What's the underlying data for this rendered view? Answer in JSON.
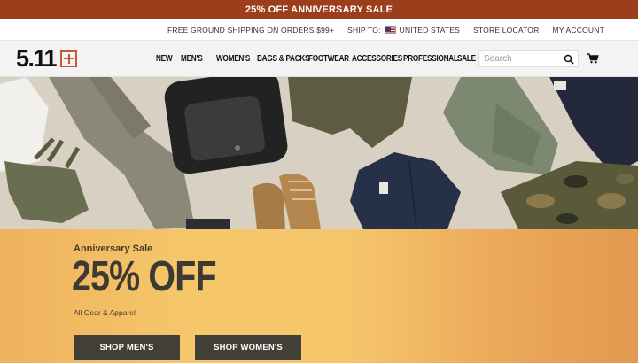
{
  "promo_bar": {
    "text": "25% OFF ANNIVERSARY SALE"
  },
  "utility": {
    "shipping": "FREE GROUND SHIPPING ON ORDERS $99+",
    "ship_to_label": "SHIP TO:",
    "ship_to_country": "UNITED STATES",
    "store_locator": "STORE LOCATOR",
    "account": "MY ACCOUNT"
  },
  "brand": {
    "logo_text": "5.11",
    "accent": "#c8583a"
  },
  "nav": {
    "items": [
      {
        "label": "NEW"
      },
      {
        "label": "MEN'S"
      },
      {
        "label": "WOMEN'S"
      },
      {
        "label": "BAGS & PACKS"
      },
      {
        "label": "FOOTWEAR"
      },
      {
        "label": "ACCESSORIES"
      },
      {
        "label": "PROFESSIONAL"
      },
      {
        "label": "SALE"
      }
    ],
    "search_placeholder": "Search",
    "icons": {
      "search": "search-icon",
      "cart": "cart-icon"
    }
  },
  "hero": {
    "eyebrow": "Anniversary Sale",
    "headline": "25% OFF",
    "subtext": "All Gear & Apparel",
    "buttons": {
      "mens": "SHOP MEN'S",
      "womens": "SHOP WOMEN'S"
    }
  },
  "colors": {
    "promo_bar": "#9c3d1c",
    "button": "#423f37",
    "panel": "#f5c56a"
  }
}
